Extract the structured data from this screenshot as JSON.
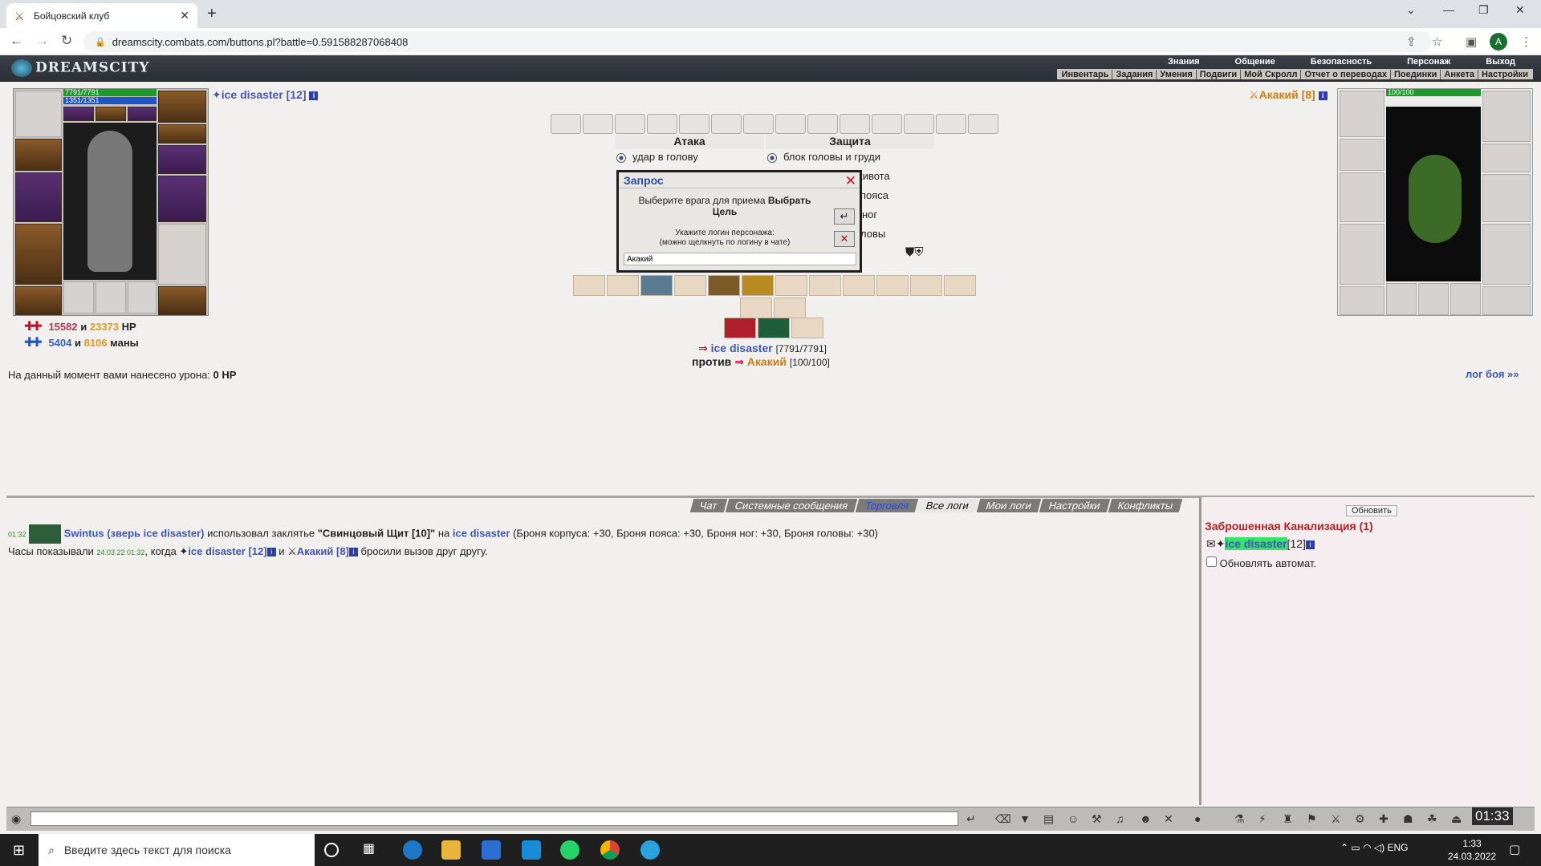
{
  "browser": {
    "tab_title": "Бойцовский клуб",
    "url": "dreamscity.combats.com/buttons.pl?battle=0.591588287068408",
    "profile_initial": "A"
  },
  "game": {
    "logo": "DREAMSCITY",
    "top_menu": [
      "Знания",
      "Общение",
      "Безопасность",
      "Персонаж",
      "Выход"
    ],
    "sub_menu": [
      "Инвентарь",
      "Задания",
      "Умения",
      "Подвиги",
      "Мой Скролл",
      "Отчет о переводах",
      "Поединки",
      "Анкета",
      "Настройки"
    ]
  },
  "player": {
    "name": "ice disaster [12]",
    "hp_text": "7791/7791",
    "mana_text": "1351/1351",
    "hp_dealt": "15582",
    "hp_total": "23373",
    "hp_unit": "HP",
    "mana_dealt": "5404",
    "mana_total": "8106",
    "mana_unit": "маны",
    "and": "и"
  },
  "damage_line": {
    "text": "На данный момент вами нанесено урона:",
    "value": "0 HP"
  },
  "fight_log_link": "лог боя »»",
  "battle": {
    "attack_header": "Атака",
    "defense_header": "Защита",
    "attack_option": "удар в голову",
    "defense_options": [
      "блок головы и груди",
      "живота",
      "пояса",
      "ног",
      "ловы"
    ],
    "vs_word": "против",
    "you_name": "ice disaster",
    "you_hp": "[7791/7791]",
    "enemy_name": "Акакий",
    "enemy_hp": "[100/100]"
  },
  "dialog": {
    "title": "Запрос",
    "message_prefix": "Выберите врага для приема",
    "message_bold": "Выбрать Цель",
    "hint_line1": "Укажите логин персонажа:",
    "hint_line2": "(можно щелкнуть по логину в чате)",
    "input_value": "Акакий"
  },
  "opponent": {
    "name": "Акакий [8]",
    "hp_text": "100/100"
  },
  "chat": {
    "tabs": [
      "Чат",
      "Системные сообщения",
      "Торговля",
      "Все логи",
      "Мои логи",
      "Настройки",
      "Конфликты"
    ],
    "active_tab": "Все логи",
    "log1": {
      "time": "01:32",
      "actor": "Swintus (зверь ice disaster)",
      "verb": "использовал заклятье",
      "spell": "\"Свинцовый Щит [10]\"",
      "on": "на",
      "target": "ice disaster",
      "effect": "(Броня корпуса: +30, Броня пояса: +30, Броня ног: +30, Броня головы: +30)"
    },
    "log2": {
      "prefix": "Часы показывали",
      "date": "24.03.22 01:32",
      "when": ", когда",
      "p1": "ice disaster [12]",
      "and": "и",
      "p2": "Акакий [8]",
      "suffix": "бросили вызов друг другу."
    }
  },
  "chat_panel": {
    "refresh_button": "Обновить",
    "room": "Заброшенная Канализация (1)",
    "user": "ice disaster",
    "user_level": "[12]",
    "auto_refresh_label": "Обновлять автомат.",
    "auto_refresh_checked": false
  },
  "game_clock": "01:33",
  "taskbar": {
    "search_placeholder": "Введите здесь текст для поиска",
    "lang": "ENG",
    "time": "1:33",
    "date": "24.03.2022"
  }
}
